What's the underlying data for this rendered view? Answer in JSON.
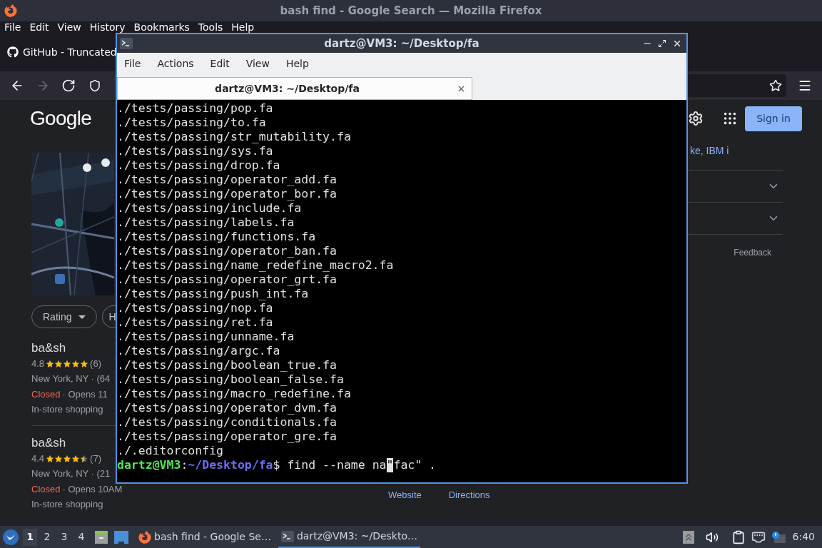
{
  "firefox": {
    "title": "bash find - Google Search — Mozilla Firefox",
    "menu": [
      "File",
      "Edit",
      "View",
      "History",
      "Bookmarks",
      "Tools",
      "Help"
    ],
    "tab": {
      "title": "GitHub - Truncated"
    },
    "nav_buttons": [
      {
        "kind": "back",
        "disabled": false
      },
      {
        "kind": "forward",
        "disabled": true
      },
      {
        "kind": "reload",
        "disabled": false
      }
    ],
    "google": {
      "logo": "Google",
      "sign_in": "Sign in",
      "filter_chips": [
        {
          "label": "Rating",
          "has_caret": true
        },
        {
          "label": "H",
          "has_caret": false
        }
      ],
      "results": [
        {
          "name": "ba&sh",
          "rating": "4.8",
          "stars": 5,
          "count": "(6)",
          "location": "New York, NY · (64",
          "status": "Closed",
          "hours": "· Opens 11",
          "service": "In-store shopping"
        },
        {
          "name": "ba&sh",
          "rating": "4.4",
          "stars": 4.5,
          "count": "(7)",
          "location": "New York, NY · (21",
          "status": "Closed",
          "hours": "· Opens 10AM",
          "service": "In-store shopping"
        }
      ],
      "side_link": "ke, IBM i",
      "feedback": "Feedback",
      "actions": [
        "Website",
        "Directions"
      ]
    }
  },
  "terminal": {
    "title": "dartz@VM3: ~/Desktop/fa",
    "menu": [
      "File",
      "Actions",
      "Edit",
      "View",
      "Help"
    ],
    "tab": {
      "title": "dartz@VM3: ~/Desktop/fa"
    },
    "lines": [
      "./tests/passing/pop.fa",
      "./tests/passing/to.fa",
      "./tests/passing/str_mutability.fa",
      "./tests/passing/sys.fa",
      "./tests/passing/drop.fa",
      "./tests/passing/operator_add.fa",
      "./tests/passing/operator_bor.fa",
      "./tests/passing/include.fa",
      "./tests/passing/labels.fa",
      "./tests/passing/functions.fa",
      "./tests/passing/operator_ban.fa",
      "./tests/passing/name_redefine_macro2.fa",
      "./tests/passing/operator_grt.fa",
      "./tests/passing/push_int.fa",
      "./tests/passing/nop.fa",
      "./tests/passing/ret.fa",
      "./tests/passing/unname.fa",
      "./tests/passing/argc.fa",
      "./tests/passing/boolean_true.fa",
      "./tests/passing/boolean_false.fa",
      "./tests/passing/macro_redefine.fa",
      "./tests/passing/operator_dvm.fa",
      "./tests/passing/conditionals.fa",
      "./tests/passing/operator_gre.fa",
      "./.editorconfig"
    ],
    "prompt": {
      "user": "dartz@VM3",
      "separator": ":",
      "path": "~/Desktop/fa",
      "symbol": "$",
      "before_cursor": " find --name na",
      "cursor": "\"",
      "after_cursor": "fac\" ."
    }
  },
  "taskbar": {
    "workspaces": [
      {
        "label": "1",
        "selected": true
      },
      {
        "label": "2",
        "selected": false
      },
      {
        "label": "3",
        "selected": false
      },
      {
        "label": "4",
        "selected": false
      }
    ],
    "tasks": [
      {
        "kind": "firefox",
        "title": "bash find - Google Se…",
        "selected": false
      },
      {
        "kind": "terminal",
        "title": "dartz@VM3: ~/Deskto…",
        "selected": true
      }
    ],
    "clock": "6:40"
  }
}
